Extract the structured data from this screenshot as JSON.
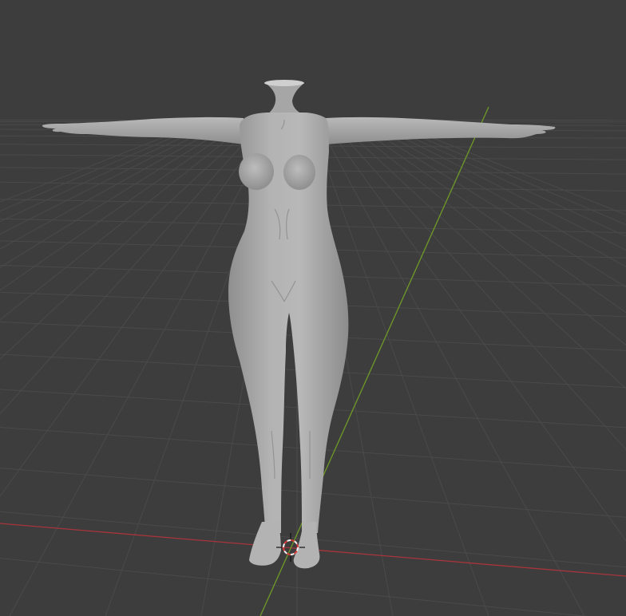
{
  "viewport": {
    "colors": {
      "background": "#3d3d3d",
      "grid_line": "#4a4a4a",
      "grid_line_far": "#474747",
      "x_axis": "#a8353c",
      "y_axis": "#6f9a27",
      "mesh_fill": "#a9a9a9",
      "mesh_shadow": "#8a8a8a",
      "mesh_highlight": "#c4c4c4",
      "cursor_red": "#d63b3b",
      "cursor_white": "#f2f2f2"
    },
    "icons": {
      "cursor": "3d-cursor-icon"
    }
  }
}
